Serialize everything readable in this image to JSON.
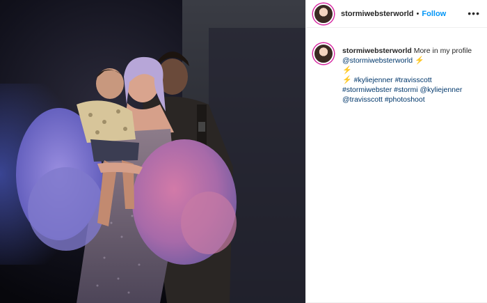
{
  "post": {
    "username": "stormiwebsterworld",
    "separator": "•",
    "follow_label": "Follow",
    "more_icon": "ellipsis-icon",
    "photo_alt": "Kylie Jenner, Stormi and Travis Scott photoshoot"
  },
  "caption": {
    "username": "stormiwebsterworld",
    "text": "More in my profile",
    "mention": "@stormiwebsterworld",
    "emoji_1": "⚡",
    "emoji_2": "⚡",
    "emoji_3": "⚡",
    "tags": [
      "#kyliejenner",
      "#travisscott",
      "#stormiwebster",
      "#stormi",
      "@kyliejenner",
      "@travisscott",
      "#photoshoot"
    ]
  },
  "colors": {
    "link": "#00376b",
    "follow": "#0095f6",
    "text": "#262626"
  }
}
